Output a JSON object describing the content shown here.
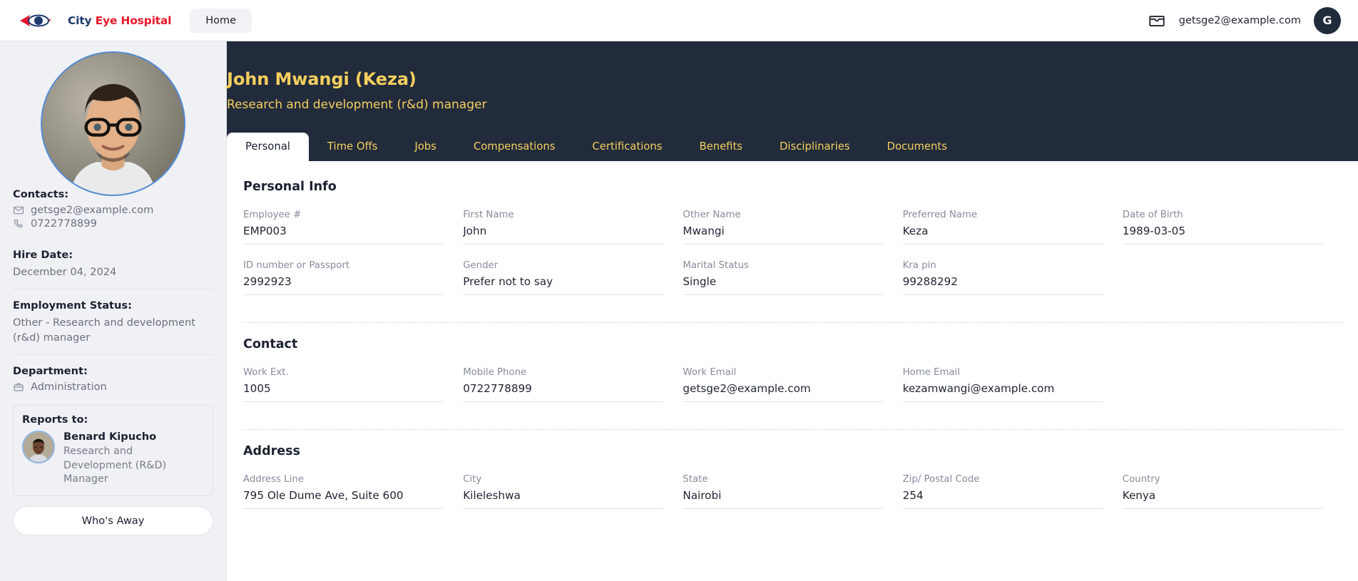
{
  "topnav": {
    "brand": {
      "city": "City ",
      "eye": "Eye ",
      "hospital": "Hospital",
      "logo_icon": "eye-logo-icon"
    },
    "home_label": "Home",
    "inbox_icon": "inbox-icon",
    "user_email": "getsge2@example.com",
    "avatar_initial": "G"
  },
  "colors": {
    "header_bg": "#212b3b",
    "accent_gold": "#f5cf5e",
    "sidebar_bg": "#f0f1f5",
    "brand_red": "#e8192c",
    "brand_blue": "#1d3a6e"
  },
  "hero": {
    "employee_name": "John Mwangi (Keza)",
    "employee_role": "Research and development (r&d) manager"
  },
  "tabs": [
    {
      "label": "Personal",
      "active": true
    },
    {
      "label": "Time Offs",
      "active": false
    },
    {
      "label": "Jobs",
      "active": false
    },
    {
      "label": "Compensations",
      "active": false
    },
    {
      "label": "Certifications",
      "active": false
    },
    {
      "label": "Benefits",
      "active": false
    },
    {
      "label": "Disciplinaries",
      "active": false
    },
    {
      "label": "Documents",
      "active": false
    }
  ],
  "sidebar": {
    "contacts_label": "Contacts:",
    "contact_email": "getsge2@example.com",
    "contact_phone": "0722778899",
    "hire_date_label": "Hire Date:",
    "hire_date_value": "December 04, 2024",
    "employment_status_label": "Employment Status:",
    "employment_status_value": "Other - Research and development (r&d) manager",
    "department_label": "Department:",
    "department_value": "Administration",
    "reports_to_label": "Reports to:",
    "manager_name": "Benard Kipucho",
    "manager_role": "Research and Development (R&D) Manager",
    "whos_away_label": "Who's Away"
  },
  "main": {
    "sections": [
      {
        "title": "Personal Info",
        "fields": [
          {
            "label": "Employee #",
            "value": "EMP003"
          },
          {
            "label": "First Name",
            "value": "John"
          },
          {
            "label": "Other Name",
            "value": "Mwangi"
          },
          {
            "label": "Preferred Name",
            "value": "Keza"
          },
          {
            "label": "Date of Birth",
            "value": "1989-03-05"
          },
          {
            "label": "ID number or Passport",
            "value": "2992923"
          },
          {
            "label": "Gender",
            "value": "Prefer not to say"
          },
          {
            "label": "Marital Status",
            "value": "Single"
          },
          {
            "label": "Kra pin",
            "value": "99288292"
          }
        ]
      },
      {
        "title": "Contact",
        "fields": [
          {
            "label": "Work Ext.",
            "value": "1005"
          },
          {
            "label": "Mobile Phone",
            "value": "0722778899"
          },
          {
            "label": "Work Email",
            "value": "getsge2@example.com"
          },
          {
            "label": "Home Email",
            "value": "kezamwangi@example.com"
          }
        ]
      },
      {
        "title": "Address",
        "fields": [
          {
            "label": "Address Line",
            "value": "795 Ole Dume Ave, Suite 600"
          },
          {
            "label": "City",
            "value": "Kileleshwa"
          },
          {
            "label": "State",
            "value": "Nairobi"
          },
          {
            "label": "Zip/ Postal Code",
            "value": "254"
          },
          {
            "label": "Country",
            "value": "Kenya"
          }
        ]
      }
    ]
  }
}
